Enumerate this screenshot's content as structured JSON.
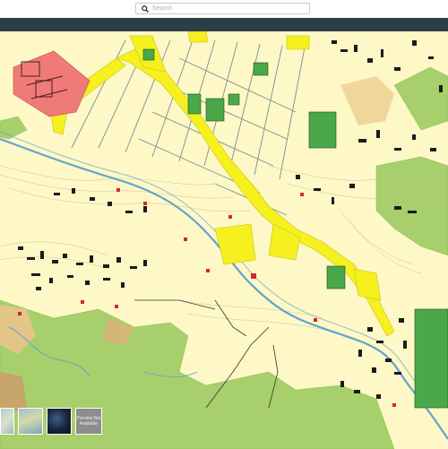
{
  "search": {
    "placeholder": "Search"
  },
  "icons": {
    "search": "search-icon"
  },
  "colors": {
    "header_strip": "#2c3f48",
    "base_land": "#fdf8c5",
    "green_fields": "#a7cf6c",
    "water": "#5fa4cf",
    "roads_highlight": "#f5f01e",
    "building_highlight_red": "#f07a78",
    "building_highlight_green": "#4aa84a"
  },
  "basemap_thumbnails": [
    {
      "name": "thumbnail-terrain",
      "label": ""
    },
    {
      "name": "thumbnail-topographic",
      "label": ""
    },
    {
      "name": "thumbnail-satellite",
      "label": ""
    },
    {
      "name": "thumbnail-unavailable",
      "label": "Preview Not Available"
    }
  ]
}
